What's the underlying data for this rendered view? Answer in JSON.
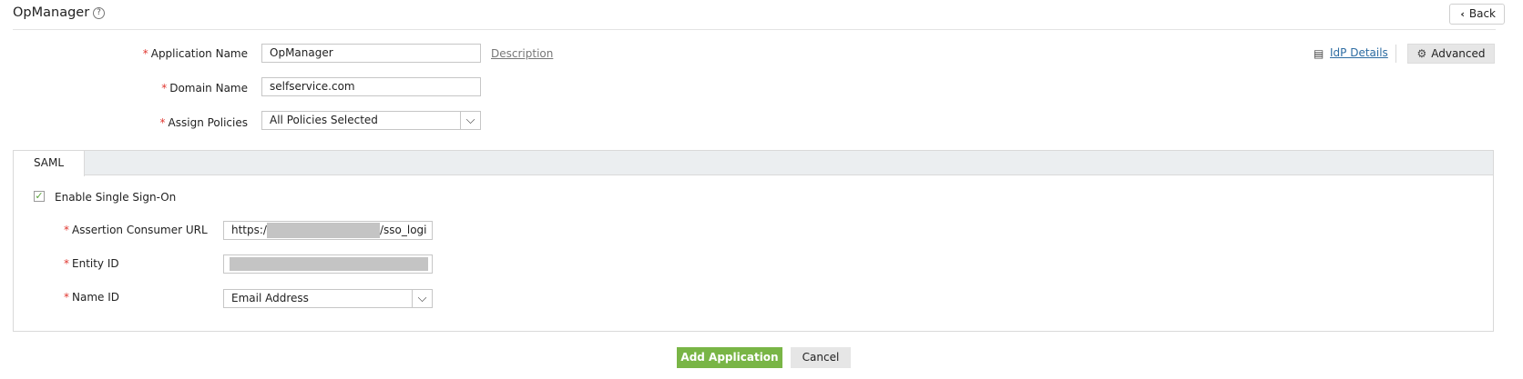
{
  "header": {
    "title": "OpManager",
    "help_icon": "?",
    "back_label": "Back"
  },
  "form": {
    "app_name": {
      "label": "Application Name",
      "value": "OpManager",
      "description_link": "Description"
    },
    "domain_name": {
      "label": "Domain Name",
      "value": "selfservice.com"
    },
    "assign_policies": {
      "label": "Assign Policies",
      "value": "All Policies Selected"
    },
    "required_mark": "*"
  },
  "actions_top": {
    "idp_details": "IdP Details",
    "advanced": "Advanced"
  },
  "saml": {
    "tab_label": "SAML",
    "enable_sso": {
      "label": "Enable Single Sign-On",
      "checked": true
    },
    "acs_url": {
      "label": "Assertion Consumer URL",
      "value_prefix": "https:/",
      "value_suffix": "/sso_logi"
    },
    "entity_id": {
      "label": "Entity ID"
    },
    "name_id": {
      "label": "Name ID",
      "value": "Email Address"
    }
  },
  "footer": {
    "add_label": "Add Application",
    "cancel_label": "Cancel"
  },
  "colors": {
    "required": "#e0362f",
    "primary_button": "#79b546",
    "link": "#2d6ca2"
  }
}
